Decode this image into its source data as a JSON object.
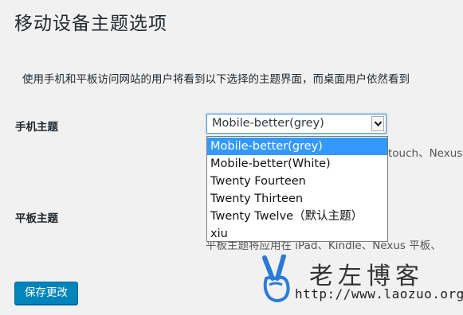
{
  "page": {
    "title": "移动设备主题选项",
    "description": "使用手机和平板访问网站的用户将看到以下选择的主题界面，而桌面用户依然看到"
  },
  "mobile": {
    "label": "手机主题",
    "selected": "Mobile-better(grey)",
    "help_visible": "touch、Nexus"
  },
  "tablet": {
    "label": "平板主题",
    "help_visible": "平板主题将应用在 iPad、Kindle、Nexus 平板、"
  },
  "dropdown": {
    "options": [
      "Mobile-better(grey)",
      "Mobile-better(White)",
      "Twenty Fourteen",
      "Twenty Thirteen",
      "Twenty Twelve（默认主题）",
      "xiu"
    ],
    "selected_index": 0
  },
  "actions": {
    "save_label": "保存更改"
  },
  "watermark": {
    "name": "老左博客",
    "url": "http://www.laozuo.org",
    "icon": "victory-hand-icon",
    "color": "#2b7bd6"
  }
}
